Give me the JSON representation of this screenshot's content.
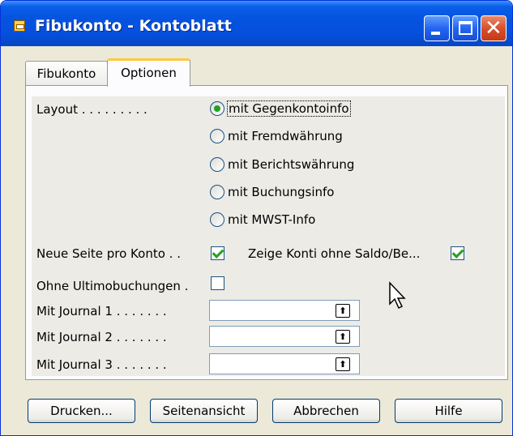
{
  "window": {
    "title": "Fibukonto - Kontoblatt"
  },
  "tabs": [
    {
      "label": "Fibukonto"
    },
    {
      "label": "Optionen"
    }
  ],
  "form": {
    "layout_label": "Layout . . . . . . . . .",
    "layout_options": [
      {
        "label": "mit Gegenkontoinfo",
        "selected": true
      },
      {
        "label": "mit Fremdwährung",
        "selected": false
      },
      {
        "label": "mit Berichtswährung",
        "selected": false
      },
      {
        "label": "mit Buchungsinfo",
        "selected": false
      },
      {
        "label": "mit MWST-Info",
        "selected": false
      }
    ],
    "new_page_label": "Neue Seite pro Konto . .",
    "new_page_checked": true,
    "show_accounts_label": "Zeige Konti ohne Saldo/Be...",
    "show_accounts_checked": true,
    "without_closing_label": "Ohne Ultimobuchungen .",
    "without_closing_checked": false,
    "journal_1_label": "Mit Journal 1 . . . . . . .",
    "journal_1_value": "",
    "journal_2_label": "Mit Journal 2 . . . . . . .",
    "journal_2_value": "",
    "journal_3_label": "Mit Journal 3 . . . . . . .",
    "journal_3_value": ""
  },
  "buttons": {
    "print": "Drucken...",
    "preview": "Seitenansicht",
    "cancel": "Abbrechen",
    "help": "Hilfe"
  },
  "colors": {
    "titlebar": "#0553e0",
    "dialog_bg": "#ece9d8",
    "check_green": "#21a121",
    "tab_highlight": "#ffc83c"
  }
}
